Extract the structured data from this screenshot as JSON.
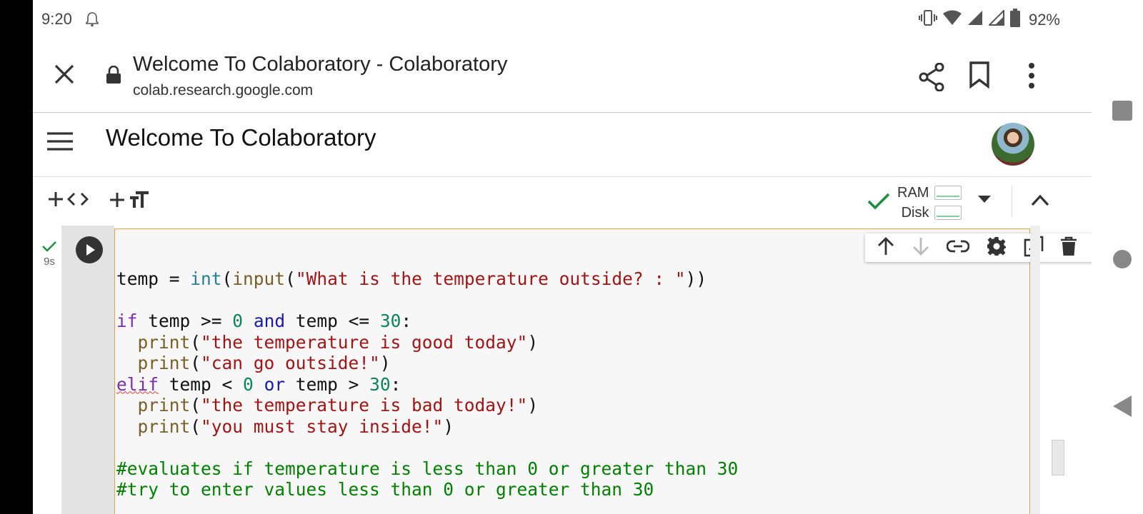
{
  "status_bar": {
    "time": "9:20",
    "battery_pct": "92%"
  },
  "browser": {
    "page_title": "Welcome To Colaboratory - Colaboratory",
    "url": "colab.research.google.com"
  },
  "notebook": {
    "title": "Welcome To Colaboratory"
  },
  "toolbar": {
    "add_code_label": "+ <>",
    "add_text_label": "+ ",
    "ram_label": "RAM",
    "disk_label": "Disk"
  },
  "cell": {
    "exec_time": "9s",
    "code_lines": [
      "temp = int(input(\"What is the temperature outside? : \"))",
      "",
      "if temp >= 0 and temp <= 30:",
      "  print(\"the temperature is good today\")",
      "  print(\"can go outside!\")",
      "elif temp < 0 or temp > 30:",
      "  print(\"the temperature is bad today!\")",
      "  print(\"you must stay inside!\")",
      "",
      "#evaluates if temperature is less than 0 or greater than 30",
      "#try to enter values less than 0 or greater than 30"
    ]
  },
  "colors": {
    "success_green": "#1e8e3e",
    "editor_border": "#e8a33b",
    "string_red": "#a31515",
    "comment_green": "#008000",
    "number_teal": "#098658",
    "keyword_purple": "#7b2fae",
    "operator_keyword_blue": "#1a1aa6"
  },
  "icons": [
    "bell-icon",
    "vibrate-icon",
    "wifi-icon",
    "signal-icon",
    "battery-icon",
    "close-icon",
    "lock-icon",
    "share-icon",
    "bookmark-icon",
    "more-vert-icon",
    "hamburger-menu-icon",
    "code-icon",
    "text-format-icon",
    "check-icon",
    "dropdown-icon",
    "collapse-icon",
    "play-icon",
    "arrow-up-icon",
    "arrow-down-icon",
    "link-icon",
    "gear-icon",
    "mirror-cell-icon",
    "trash-icon",
    "square-icon",
    "circle-icon",
    "back-triangle-icon"
  ]
}
